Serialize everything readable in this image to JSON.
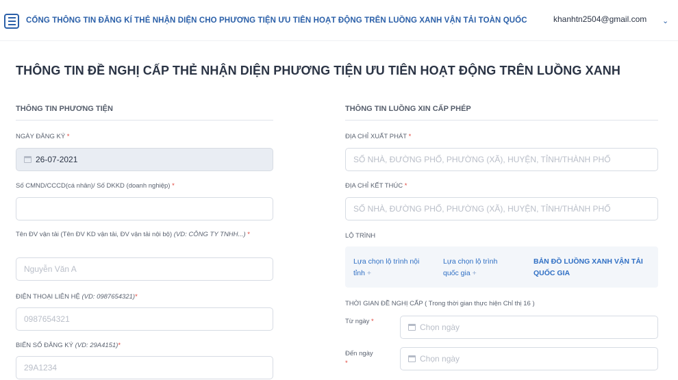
{
  "header": {
    "title": "CỔNG THÔNG TIN ĐĂNG KÍ THẺ NHẬN DIỆN CHO PHƯƠNG TIỆN ƯU TIÊN HOẠT ĐỘNG TRÊN LUỒNG XANH VẬN TẢI TOÀN QUỐC",
    "user_email": "khanhtn2504@gmail.com",
    "chevron": "⌄"
  },
  "page_title": "THÔNG TIN ĐỀ NGHỊ CẤP THẺ NHẬN DIỆN PHƯƠNG TIỆN ƯU TIÊN HOẠT ĐỘNG TRÊN LUỒNG XANH",
  "vehicle": {
    "section_title": "THÔNG TIN PHƯƠNG TIỆN",
    "reg_date_label": "NGÀY ĐĂNG KÝ",
    "reg_date_value": "26-07-2021",
    "id_label": "Số CMND/CCCD(cá nhân)/ Số DKKD (doanh nghiệp)",
    "id_value": "",
    "company_label": "Tên ĐV vận tải (Tên ĐV KD vận tải, ĐV vận tải nội bộ)",
    "company_hint": "(VD: CÔNG TY TNHH...)",
    "company_placeholder": "Nguyễn Văn A",
    "phone_label": "ĐIỆN THOẠI LIÊN HỆ",
    "phone_hint": "(VD: 0987654321)",
    "phone_placeholder": "0987654321",
    "plate_label": "BIỂN SỐ ĐĂNG KÝ",
    "plate_hint": "(VD: 29A4151)",
    "plate_placeholder": "29A1234",
    "required_mark": "*"
  },
  "route": {
    "section_title": "THÔNG TIN LUỒNG XIN CẤP PHÉP",
    "start_label": "ĐỊA CHỈ XUẤT PHÁT",
    "start_placeholder": "SỐ NHÀ, ĐƯỜNG PHỐ, PHƯỜNG (XÃ), HUYỆN, TỈNH/THÀNH PHỐ",
    "end_label": "ĐỊA CHỈ KẾT THÚC",
    "end_placeholder": "SỐ NHÀ, ĐƯỜNG PHỐ, PHƯỜNG (XÃ), HUYỆN, TỈNH/THÀNH PHỐ",
    "itinerary_label": "LỘ TRÌNH",
    "inner_route_line1": "Lựa chọn lộ trình nội",
    "inner_route_line2": "tỉnh",
    "national_route_line1": "Lựa chọn lộ trình",
    "national_route_line2": "quốc gia",
    "plus": "+",
    "map_line1": "BẢN ĐỒ LUỒNG XANH VẬN TẢI",
    "map_line2": "QUỐC GIA",
    "period_label": "THỜI GIAN ĐỀ NGHỊ CẤP ( Trong thời gian thực hiện Chỉ thị 16 )",
    "from_label": "Từ ngày",
    "to_label": "Đến ngày",
    "date_placeholder": "Chọn ngày",
    "required_mark": "*"
  },
  "icons": {
    "menu": "hamburger-menu-icon",
    "chevron": "chevron-down-icon",
    "calendar": "calendar-icon"
  },
  "colors": {
    "accent": "#2a5fa8",
    "link": "#2f6fc4",
    "required": "#e0443a",
    "filled_bg": "#e9edf3",
    "route_box_bg": "#f3f6fa"
  }
}
